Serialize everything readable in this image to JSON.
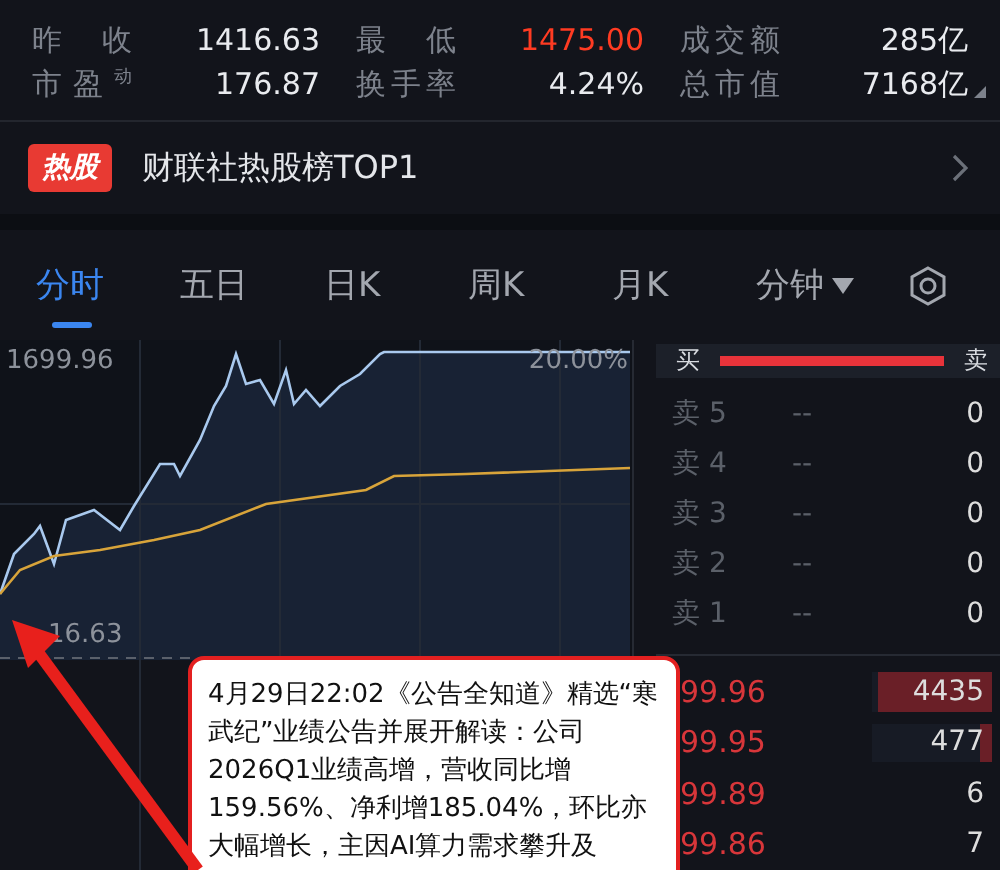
{
  "stats": [
    {
      "label": "昨 收",
      "value": "1416.63",
      "highlighted": false,
      "label2": "最 低",
      "value2": "1475.00",
      "highlighted2": true,
      "label3": "成交额",
      "value3": "285亿"
    },
    {
      "label": "市盈$^{动}$",
      "value": "176.87",
      "highlighted": false,
      "label2": "换手率",
      "value2": "4.24%",
      "highlighted2": false,
      "label3": "总市值",
      "value3": "7168亿"
    }
  ],
  "hot_banner": {
    "badge": "热股",
    "text": "财联社热股榜TOP1"
  },
  "tabs": [
    {
      "label": "分时",
      "selected": true,
      "kind": "tab"
    },
    {
      "label": "五日",
      "selected": false,
      "kind": "tab"
    },
    {
      "label": "日K",
      "selected": false,
      "kind": "tab"
    },
    {
      "label": "周K",
      "selected": false,
      "kind": "tab"
    },
    {
      "label": "月K",
      "selected": false,
      "kind": "tab"
    },
    {
      "label": "分钟",
      "selected": false,
      "kind": "dropdown"
    }
  ],
  "chart": {
    "top_price": "1699.96",
    "top_percent": "20.00%",
    "base_price": "16.63"
  },
  "order_book": {
    "buy_label": "买",
    "sell_label": "卖",
    "ratio": {
      "level": 1
    },
    "asks": [
      {
        "label": "卖 5",
        "price": "--",
        "volume": "0"
      },
      {
        "label": "卖 4",
        "price": "--",
        "volume": "0"
      },
      {
        "label": "卖 3",
        "price": "--",
        "volume": "0"
      },
      {
        "label": "卖 2",
        "price": "--",
        "volume": "0"
      },
      {
        "label": "卖 1",
        "price": "--",
        "volume": "0"
      }
    ],
    "bids": [
      {
        "price": "99.96",
        "volume": "4435",
        "level": 0.95
      },
      {
        "price": "99.95",
        "volume": "477",
        "level": 0.1
      },
      {
        "price": "99.89",
        "volume": "6"
      },
      {
        "price": "99.86",
        "volume": "7"
      }
    ]
  },
  "callout": {
    "text": "4月29日22:02《公告全知道》精选“寒武纪”业绩公告并展开解读：公司2026Q1业绩高增，营收同比增159.56%、净利增185.04%，环比亦大幅增长，主因AI算力需求攀升及"
  }
}
